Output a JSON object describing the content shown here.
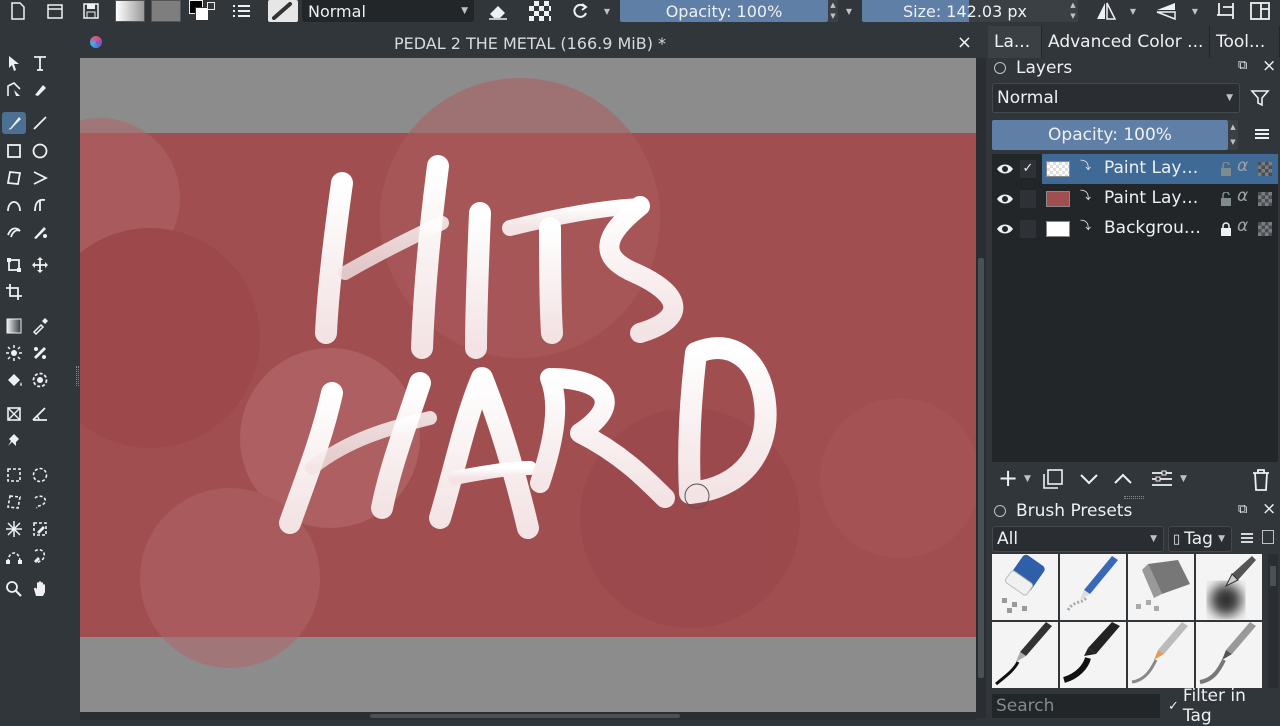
{
  "toolbar": {
    "blend_mode": "Normal",
    "opacity": "Opacity: 100%",
    "size": "Size: 142.03 px"
  },
  "document": {
    "title": "PEDAL 2 THE METAL (166.9 MiB) *",
    "close_glyph": "×",
    "canvas_text_line1": "HITS",
    "canvas_text_line2": "HARD",
    "canvas_color": "#a14e50"
  },
  "dock": {
    "tabs": [
      "La...",
      "Advanced Color ...",
      "Tool..."
    ],
    "layers_title": "Layers",
    "layer_blend": "Normal",
    "layer_opacity": "Opacity:  100%",
    "layers": [
      {
        "name": "Paint Laye...",
        "selected": true,
        "checked": true,
        "thumb": "checker",
        "locked": false
      },
      {
        "name": "Paint Laye...",
        "selected": false,
        "checked": false,
        "thumb": "#a14e50",
        "locked": false
      },
      {
        "name": "Background",
        "selected": false,
        "checked": false,
        "thumb": "#ffffff",
        "locked": true
      }
    ],
    "brush_title": "Brush Presets",
    "brush_filter": "All",
    "tag_label": "Tag",
    "search_placeholder": "Search",
    "filter_in_tag": "Filter in Tag",
    "check_glyph": "✓"
  },
  "colors": {
    "accent_blue": "#5f7fa6",
    "selection_blue": "#3f6a95",
    "panel_bg": "#31363b",
    "canvas_bg": "#8c8c8c"
  },
  "icons": {
    "toolbar": [
      "new-document-icon",
      "open-icon",
      "save-icon",
      "gradient-icon",
      "pattern-icon",
      "color-swatch-icon",
      "brush-preset-icon",
      "eraser-icon",
      "alpha-lock-icon",
      "reload-icon",
      "mirror-horizontal-icon",
      "mirror-vertical-icon",
      "wrap-around-icon",
      "canvas-only-icon"
    ]
  }
}
